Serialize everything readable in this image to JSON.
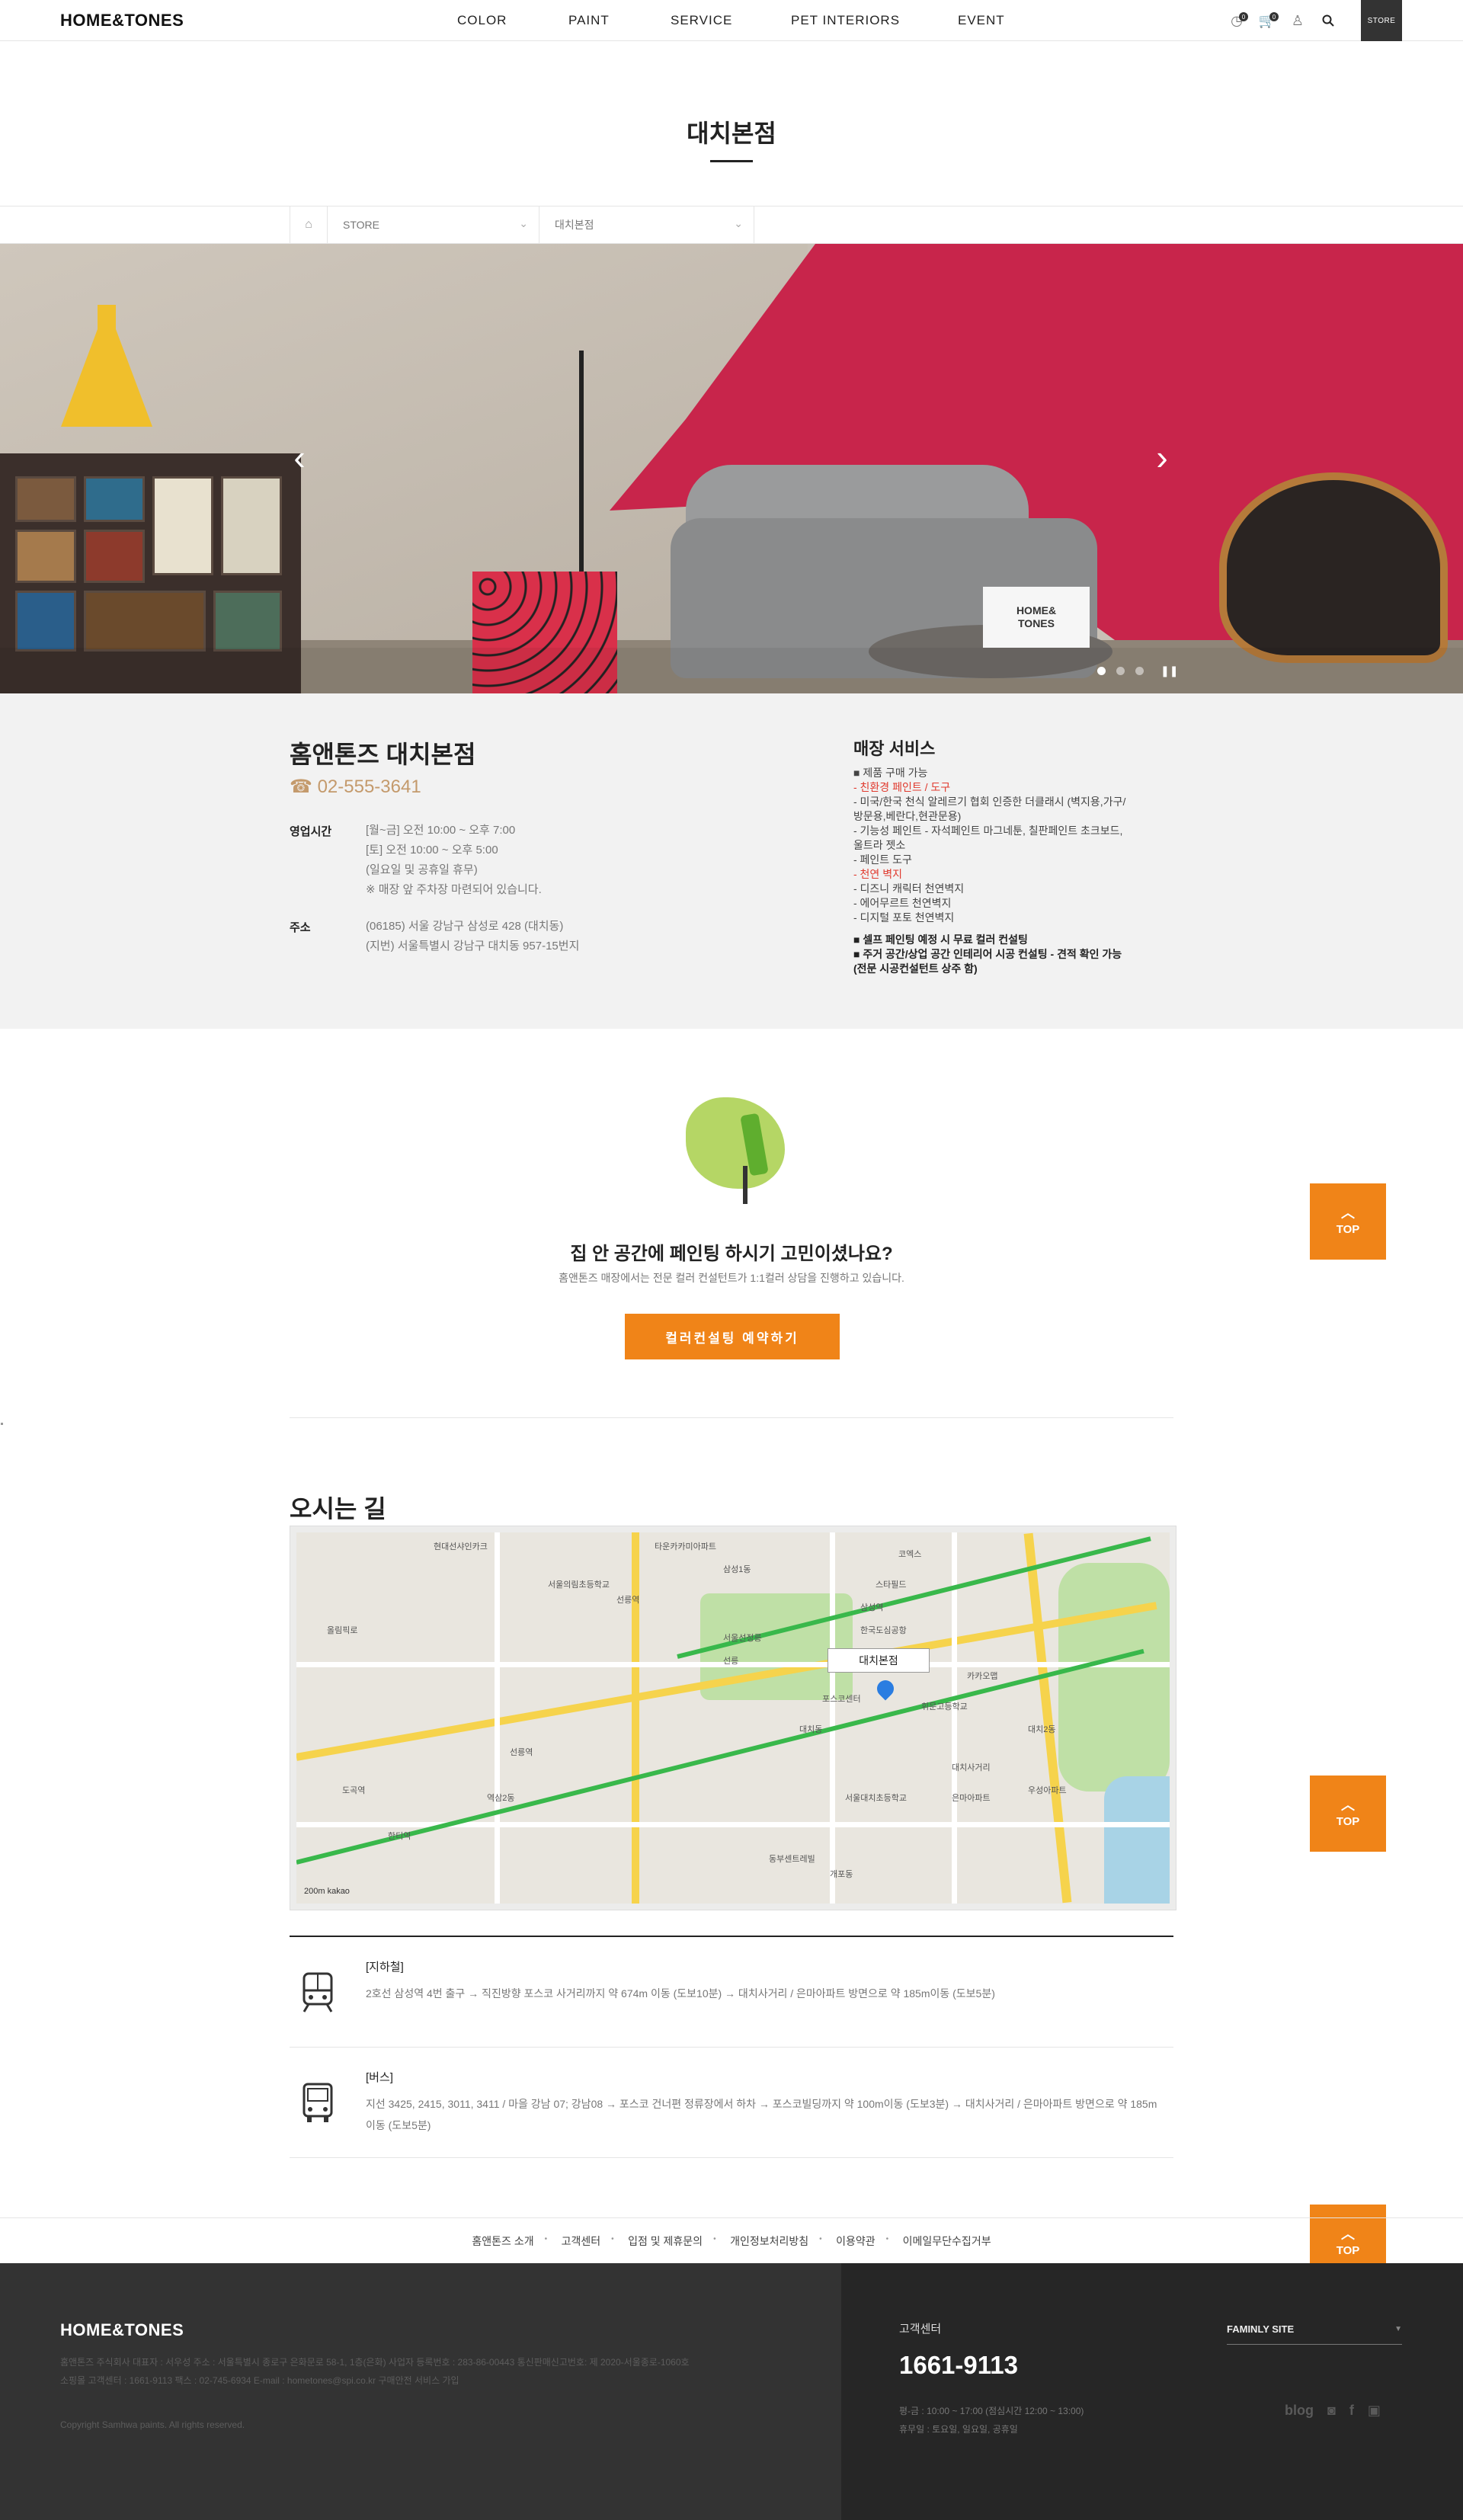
{
  "header": {
    "logo": "HOME&TONES",
    "nav": [
      "COLOR",
      "PAINT",
      "SERVICE",
      "PET INTERIORS",
      "EVENT"
    ],
    "recent_count": "0",
    "cart_count": "0",
    "store_label": "STORE"
  },
  "page": {
    "title": "대치본점"
  },
  "breadcrumb": {
    "level1": "STORE",
    "level2": "대치본점"
  },
  "hero": {
    "sign_text": "HOME&\nTONES",
    "prev_arrow": "‹",
    "next_arrow": "›",
    "slide_count": 3,
    "active_slide": 1,
    "pause_icon": "❚❚"
  },
  "store": {
    "name": "홈앤톤즈 대치본점",
    "phone": "02-555-3641",
    "hours_label": "영업시간",
    "hours": [
      "[월~금] 오전 10:00 ~ 오후 7:00",
      "[토] 오전 10:00 ~ 오후 5:00",
      "(일요일 및 공휴일 휴무)",
      "※ 매장 앞 주차장 마련되어 있습니다."
    ],
    "address_label": "주소",
    "address": [
      "(06185) 서울 강남구 삼성로 428 (대치동)",
      "(지번) 서울특별시 강남구 대치동 957-15번지"
    ]
  },
  "services": {
    "title": "매장 서비스",
    "lines": [
      {
        "text": "■ 제품 구매 가능",
        "style": "normal"
      },
      {
        "text": "- 친환경 페인트 / 도구",
        "style": "red"
      },
      {
        "text": "- 미국/한국 천식 알레르기 협회 인증한 더클래시 (벽지용,가구/",
        "style": "normal"
      },
      {
        "text": "방문용,베란다,현관문용)",
        "style": "normal"
      },
      {
        "text": "- 기능성 페인트 - 자석페인트 마그네툰, 칠판페인트 초크보드,",
        "style": "normal"
      },
      {
        "text": "울트라 젯소",
        "style": "normal"
      },
      {
        "text": "- 페인트 도구",
        "style": "normal"
      },
      {
        "text": "- 천연 벽지",
        "style": "red"
      },
      {
        "text": "- 디즈니 캐릭터 천연벽지",
        "style": "normal"
      },
      {
        "text": "- 에어무르트 천연벽지",
        "style": "normal"
      },
      {
        "text": "- 디지털 포토 천연벽지",
        "style": "normal"
      },
      {
        "text": "",
        "style": "normal"
      },
      {
        "text": "■ 셀프 페인팅 예정 시 무료 컬러 컨설팅",
        "style": "bold"
      },
      {
        "text": "■ 주거 공간/상업 공간 인테리어 시공 컨설팅 - 견적 확인 가능",
        "style": "bold"
      },
      {
        "text": "(전문 시공컨설턴트 상주 함)",
        "style": "bold"
      }
    ]
  },
  "consult": {
    "question": "집 안 공간에 페인팅 하시기 고민이셨나요?",
    "subtitle": "홈앤톤즈 매장에서는 전문 컬러 컨설턴트가 1:1컬러 상담을 진행하고 있습니다.",
    "button": "컬러컨설팅 예약하기"
  },
  "top_label": "TOP",
  "map": {
    "title": "오시는 길",
    "callout": "대치본점",
    "scale": "200m kakao",
    "labels": [
      "현대선샤인카크",
      "서울의림초등학교",
      "타운카카미아파트",
      "선릉역",
      "삼성1동",
      "삼성역",
      "코엑스",
      "스타필드",
      "서울선정릉",
      "한국도심공항",
      "선릉",
      "대치동",
      "도곡역",
      "한티역",
      "대치2동",
      "은마아파트",
      "휘문고등학교",
      "서울대치초등학교",
      "포스코센터",
      "대치사거리",
      "역삼2동",
      "우성아파트",
      "선릉역",
      "카카오맵",
      "올림픽로",
      "동부센트레빌",
      "개포동"
    ]
  },
  "directions": [
    {
      "heading": "[지하철]",
      "text": "2호선 삼성역 4번 출구 → 직진방향 포스코 사거리까지 약 674m 이동 (도보10분) → 대치사거리 / 은마아파트 방면으로 약 185m이동 (도보5분)"
    },
    {
      "heading": "[버스]",
      "text": "지선 3425, 2415, 3011, 3411 / 마을 강남 07; 강남08 → 포스코 건너편 정류장에서 하차 → 포스코빌딩까지 약 100m이동 (도보3분) → 대치사거리 / 은마아파트 방면으로 약 185m 이동 (도보5분)"
    }
  ],
  "footer_links": [
    "홈앤톤즈 소개",
    "고객센터",
    "입점 및 제휴문의",
    "개인정보처리방침",
    "이용약관",
    "이메일무단수집거부"
  ],
  "footer": {
    "logo": "HOME&TONES",
    "info1": "홈앤톤즈 주식회사 대표자 : 서우성   주소 : 서울특별시 종로구 은화문로 58-1, 1층(은화)   사업자 등록번호 : 283-86-00443   통신판매신고번호: 제 2020-서울종로-1060호",
    "info2": "소핑몰 고객센터 : 1661-9113   팩스 : 02-745-6934   E-mail : hometones@spi.co.kr   구매안전 서비스 가입",
    "copyright": "Copyright Samhwa paints. All rights reserved.",
    "cs_label": "고객센터",
    "cs_number": "1661-9113",
    "cs_hours1": "평-금 : 10:00 ~ 17:00 (점심시간 12:00 ~ 13:00)",
    "cs_hours2": "휴무일 : 토요일, 일요일, 공휴일",
    "family_label": "FAMINLY SITE",
    "sns": [
      "blog",
      "instagram-icon",
      "facebook-icon",
      "kakao-icon"
    ]
  }
}
